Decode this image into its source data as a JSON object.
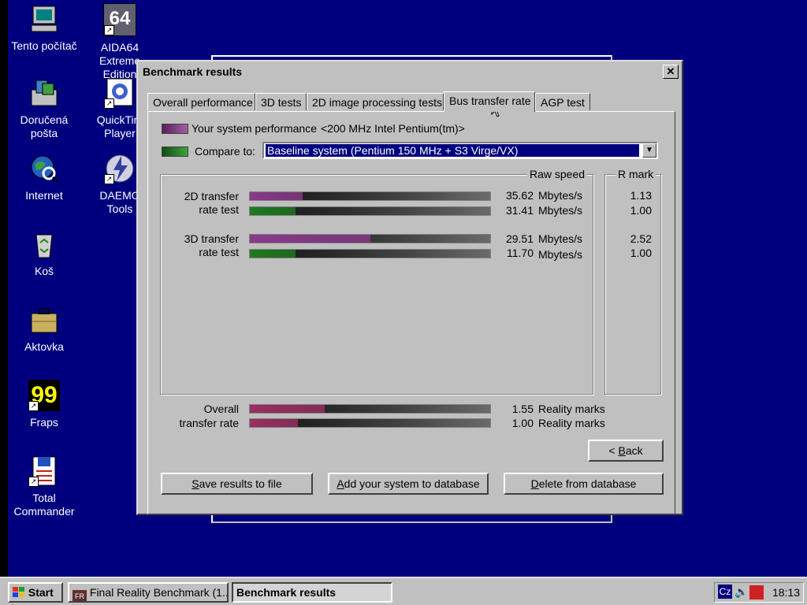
{
  "desktop": {
    "icons": [
      {
        "label": "Tento počítač",
        "icon": "computer-icon"
      },
      {
        "label": "Doručená\npošta",
        "icon": "inbox-icon"
      },
      {
        "label": "Internet",
        "icon": "internet-globe-icon"
      },
      {
        "label": "Koš",
        "icon": "recycle-bin-icon"
      },
      {
        "label": "Aktovka",
        "icon": "briefcase-icon"
      },
      {
        "label": "Fraps",
        "icon": "fraps-icon",
        "glyph": "99"
      },
      {
        "label": "Total\nCommander",
        "icon": "total-commander-icon"
      },
      {
        "label": "AIDA64\nExtreme\nEdition",
        "icon": "aida64-icon",
        "glyph": "64"
      },
      {
        "label": "QuickTim\nPlayer",
        "icon": "quicktime-icon"
      },
      {
        "label": "DAEMO\nTools",
        "icon": "daemon-tools-icon"
      }
    ]
  },
  "dialog": {
    "title": "Benchmark results",
    "close_glyph": "✕",
    "tabs": [
      "Overall performance",
      "3D tests",
      "2D image processing tests",
      "Bus transfer rate",
      "AGP test"
    ],
    "active_tab": "Bus transfer rate",
    "your_system_label": "Your system performance",
    "your_system_value": "<200 MHz Intel Pentium(tm)>",
    "compare_label": "Compare to:",
    "compare_value": "Baseline system (Pentium 150 MHz + S3 Virge/VX)",
    "raw_speed_header": "Raw speed",
    "r_mark_header": "R mark",
    "tests": [
      {
        "label_line1": "2D transfer",
        "label_line2": "rate test",
        "rows": [
          {
            "value": "35.62",
            "unit": "Mbytes/s",
            "rmark": "1.13",
            "fill": 0.22,
            "kind": "yours"
          },
          {
            "value": "31.41",
            "unit": "Mbytes/s",
            "rmark": "1.00",
            "fill": 0.19,
            "kind": "baseline"
          }
        ]
      },
      {
        "label_line1": "3D transfer",
        "label_line2": "rate test",
        "rows": [
          {
            "value": "29.51",
            "unit": "Mbytes/s",
            "rmark": "2.52",
            "fill": 0.5,
            "kind": "yours"
          },
          {
            "value": "11.70",
            "unit": "Mbytes/s",
            "rmark": "1.00",
            "fill": 0.19,
            "kind": "baseline"
          }
        ]
      }
    ],
    "overall": {
      "label_line1": "Overall",
      "label_line2": "transfer rate",
      "rows": [
        {
          "value": "1.55",
          "unit": "Reality marks",
          "fill": 0.31,
          "kind": "yours"
        },
        {
          "value": "1.00",
          "unit": "Reality marks",
          "fill": 0.2,
          "kind": "baseline"
        }
      ]
    },
    "colors": {
      "yours": "#8a3a8a",
      "baseline": "#1f7a1f",
      "overall_yours": "#9a3060",
      "overall_baseline": "#9a3060"
    },
    "buttons": {
      "back": {
        "accel": "B",
        "rest": "ack",
        "prefix": "< "
      },
      "save": {
        "accel": "S",
        "rest": "ave results to file"
      },
      "add": {
        "accel": "A",
        "rest": "dd your system to database"
      },
      "delete": {
        "accel": "D",
        "rest": "elete from database"
      }
    }
  },
  "taskbar": {
    "start_label": "Start",
    "tasks": [
      {
        "label": "Final Reality Benchmark (1...",
        "icon": "fr-benchmark-icon"
      },
      {
        "label": "Benchmark results"
      }
    ],
    "tray": {
      "language": "Cz",
      "time": "18:13"
    }
  }
}
